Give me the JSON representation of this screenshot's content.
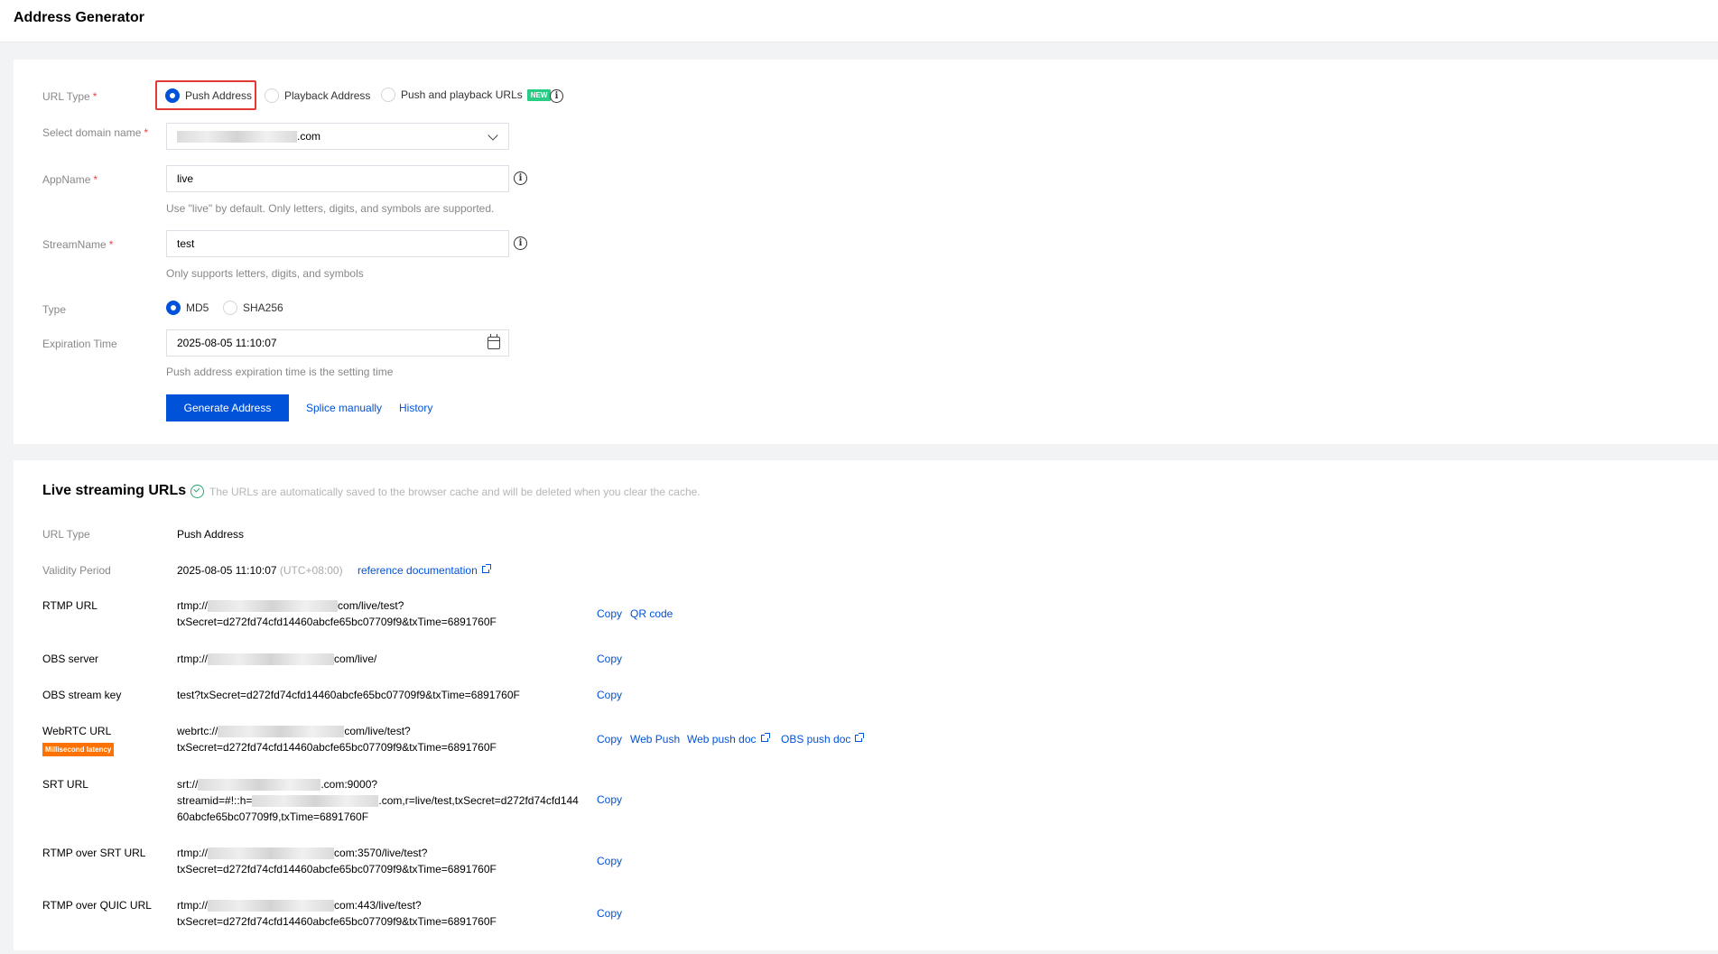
{
  "page": {
    "title": "Address Generator"
  },
  "form": {
    "url_type_label": "URL Type",
    "url_type_options": [
      {
        "label": "Push Address",
        "selected": true
      },
      {
        "label": "Playback Address",
        "selected": false
      },
      {
        "label": "Push and playback URLs",
        "selected": false,
        "badge": "NEW"
      }
    ],
    "domain_label": "Select domain name",
    "domain_value_suffix": ".com",
    "appname_label": "AppName",
    "appname_value": "live",
    "appname_hint": "Use \"live\" by default. Only letters, digits, and symbols are supported.",
    "streamname_label": "StreamName",
    "streamname_value": "test",
    "streamname_hint": "Only supports letters, digits, and symbols",
    "type_label": "Type",
    "type_options": [
      {
        "label": "MD5",
        "selected": true
      },
      {
        "label": "SHA256",
        "selected": false
      }
    ],
    "expiration_label": "Expiration Time",
    "expiration_value": "2025-08-05 11:10:07",
    "expiration_hint": "Push address expiration time is the setting time",
    "generate_button": "Generate Address",
    "splice_link": "Splice manually",
    "history_link": "History",
    "required_mark": "*"
  },
  "results": {
    "title": "Live streaming URLs",
    "note": "The URLs are automatically saved to the browser cache and will be deleted when you clear the cache.",
    "url_type_label": "URL Type",
    "url_type_value": "Push Address",
    "validity_label": "Validity Period",
    "validity_value": "2025-08-05 11:10:07",
    "validity_tz": "(UTC+08:00)",
    "reference_doc": "reference documentation",
    "copy": "Copy",
    "qr_code": "QR code",
    "web_push": "Web Push",
    "web_push_doc": "Web push doc",
    "obs_push_doc": "OBS push doc",
    "latency_badge": "Millisecond latency",
    "rows": {
      "rtmp": {
        "label": "RTMP URL",
        "prefix": "rtmp://",
        "suffix": "com/live/test?",
        "line2": "txSecret=d272fd74cfd14460abcfe65bc07709f9&txTime=6891760F"
      },
      "obs_server": {
        "label": "OBS server",
        "prefix": "rtmp://",
        "suffix": "com/live/"
      },
      "obs_key": {
        "label": "OBS stream key",
        "value": "test?txSecret=d272fd74cfd14460abcfe65bc07709f9&txTime=6891760F"
      },
      "webrtc": {
        "label": "WebRTC URL",
        "prefix": "webrtc://",
        "suffix": "com/live/test?",
        "line2": "txSecret=d272fd74cfd14460abcfe65bc07709f9&txTime=6891760F"
      },
      "srt": {
        "label": "SRT URL",
        "prefix": "srt://",
        "suffix": ".com:9000?",
        "line2_prefix": "streamid=#!::h=",
        "line2_suffix": ".com,r=live/test,txSecret=d272fd74cfd144",
        "line3": "60abcfe65bc07709f9,txTime=6891760F"
      },
      "rtmp_srt": {
        "label": "RTMP over SRT URL",
        "prefix": "rtmp://",
        "suffix": "com:3570/live/test?",
        "line2": "txSecret=d272fd74cfd14460abcfe65bc07709f9&txTime=6891760F"
      },
      "rtmp_quic": {
        "label": "RTMP over QUIC URL",
        "prefix": "rtmp://",
        "suffix": "com:443/live/test?",
        "line2": "txSecret=d272fd74cfd14460abcfe65bc07709f9&txTime=6891760F"
      }
    }
  },
  "colors": {
    "accent": "#0052d9",
    "required": "#e54545",
    "success": "#2ba471",
    "badge_new": "#29cc85",
    "badge_latency": "#ff7200",
    "highlight": "#e53935"
  },
  "icons": [
    "info-icon",
    "chevron-down-icon",
    "calendar-icon",
    "check-circle-icon",
    "external-link-icon"
  ]
}
